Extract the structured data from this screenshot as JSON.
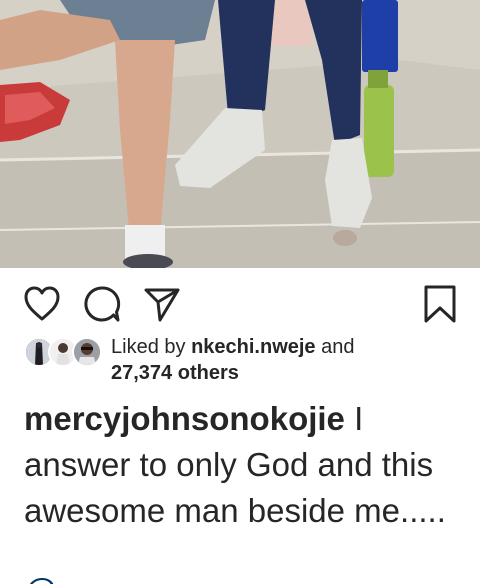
{
  "post": {
    "likes": {
      "prefix": "Liked by",
      "user": "nkechi.nweje",
      "conj": "and",
      "others": "27,374 others"
    },
    "caption": {
      "username": "mercyjohnsonokojie",
      "text": "I answer to only God and this awesome man beside me....."
    },
    "mention_partial": "@"
  },
  "icons": {
    "like": "heart-icon",
    "comment": "comment-icon",
    "share": "direct-share-icon",
    "save": "bookmark-icon"
  },
  "colors": {
    "text": "#262626",
    "link": "#003569",
    "background": "#ffffff"
  }
}
